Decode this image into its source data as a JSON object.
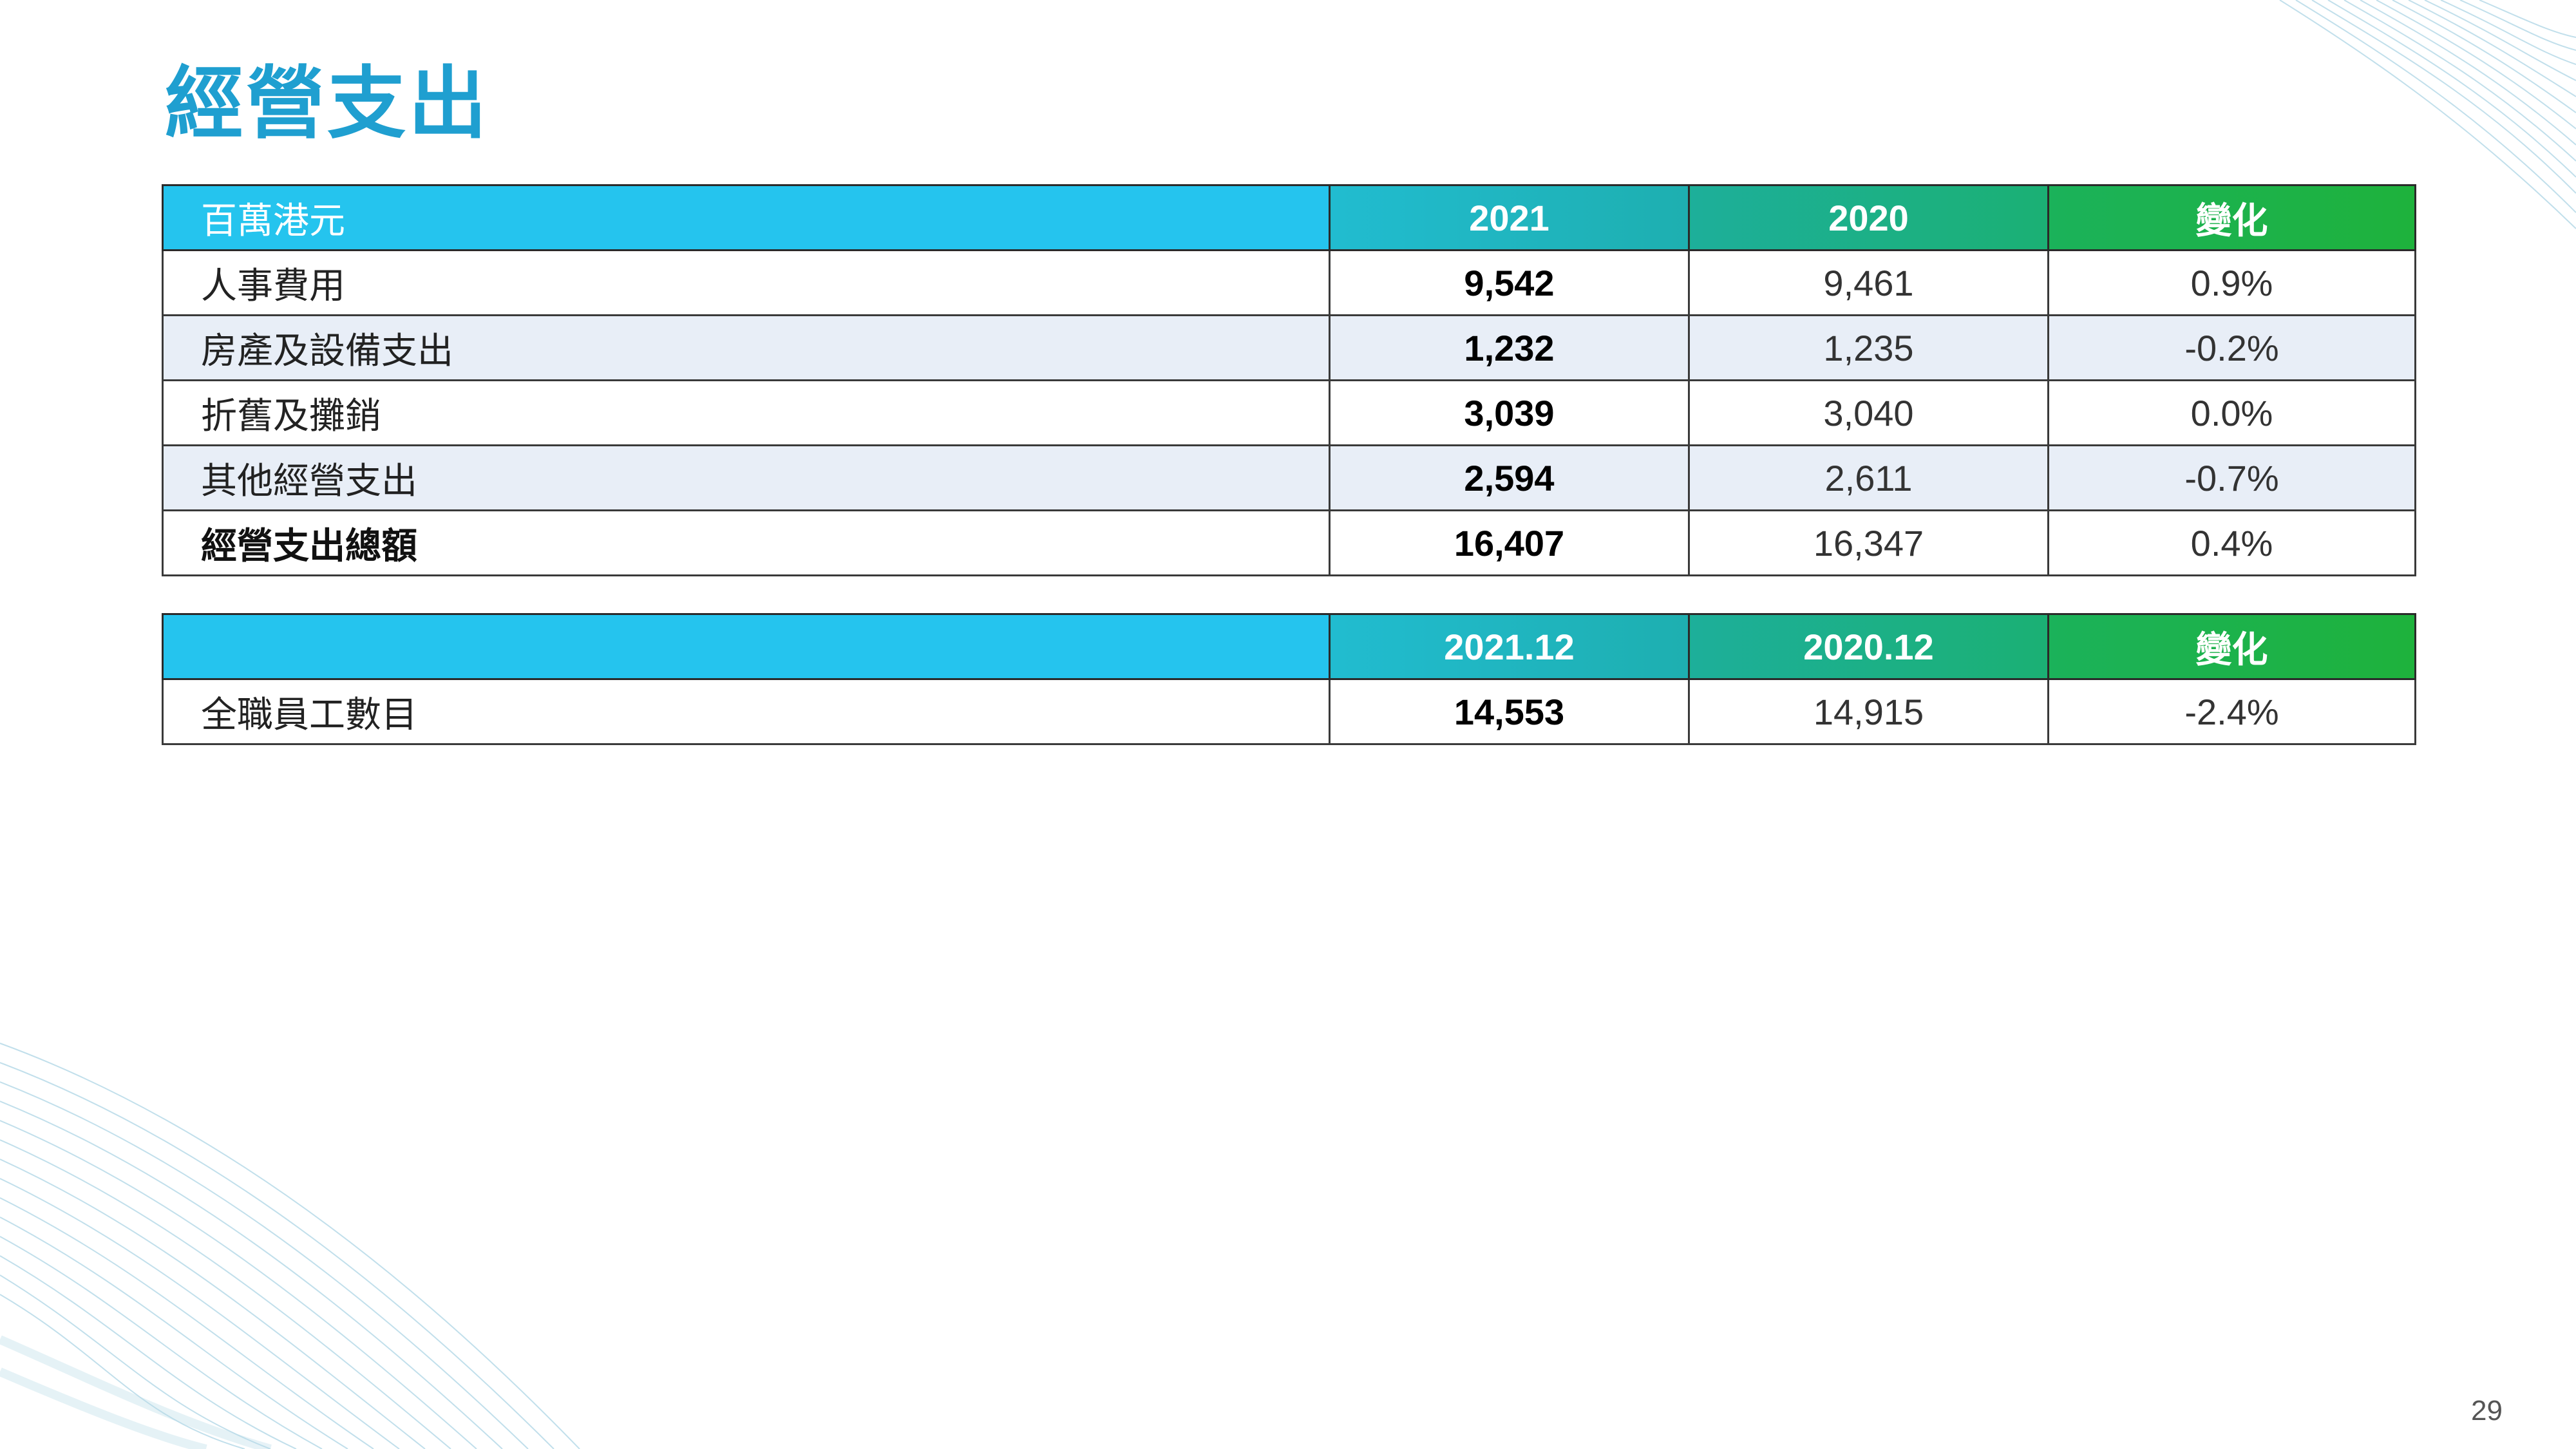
{
  "title": "經營支出",
  "table1": {
    "headers": [
      "百萬港元",
      "2021",
      "2020",
      "變化"
    ],
    "rows": [
      {
        "label": "人事費用",
        "current": "9,542",
        "previous": "9,461",
        "change": "0.9%"
      },
      {
        "label": "房產及設備支出",
        "current": "1,232",
        "previous": "1,235",
        "change": "-0.2%"
      },
      {
        "label": "折舊及攤銷",
        "current": "3,039",
        "previous": "3,040",
        "change": "0.0%"
      },
      {
        "label": "其他經營支出",
        "current": "2,594",
        "previous": "2,611",
        "change": "-0.7%"
      },
      {
        "label": "經營支出總額",
        "current": "16,407",
        "previous": "16,347",
        "change": "0.4%"
      }
    ]
  },
  "table2": {
    "headers": [
      "",
      "2021.12",
      "2020.12",
      "變化"
    ],
    "rows": [
      {
        "label": "全職員工數目",
        "current": "14,553",
        "previous": "14,915",
        "change": "-2.4%"
      }
    ]
  },
  "page_number": "29",
  "colors": {
    "title": "#1f9fd0",
    "header_start": "#25c4ee",
    "header_end": "#1eb23c",
    "row_alt": "#e8eef7"
  }
}
